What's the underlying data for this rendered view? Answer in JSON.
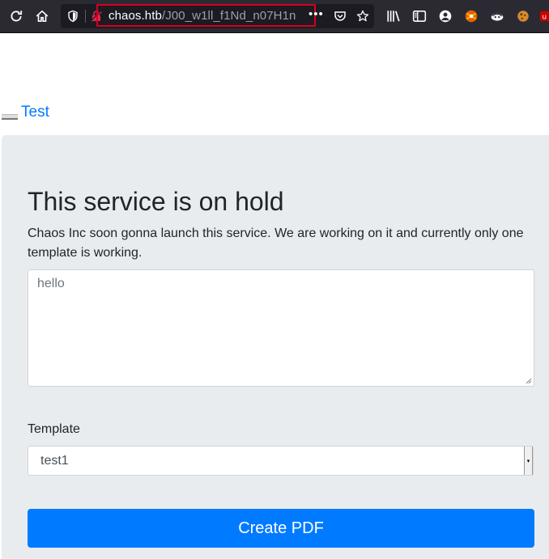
{
  "browser": {
    "url_host": "chaos.htb",
    "url_path": "/J00_w1ll_f1Nd_n07H1n",
    "url_overflow": "•••",
    "accent_highlight": "#d70022"
  },
  "page": {
    "top_link": "Test",
    "title": "This service is on hold",
    "lead": "Chaos Inc soon gonna launch this service. We are working on it and currently only one template is working.",
    "textarea_placeholder": "hello",
    "template_label": "Template",
    "template_selected": "test1",
    "select_arrow": "▾",
    "submit_label": "Create PDF",
    "accent": "#007bff",
    "panel_bg": "#e9ecef"
  },
  "icons": [
    "reload-icon",
    "home-icon",
    "tracking-shield-icon",
    "insecure-lock-icon",
    "pocket-icon",
    "bookmark-star-icon",
    "library-icon",
    "sidebar-icon",
    "account-icon",
    "extension-icon"
  ]
}
